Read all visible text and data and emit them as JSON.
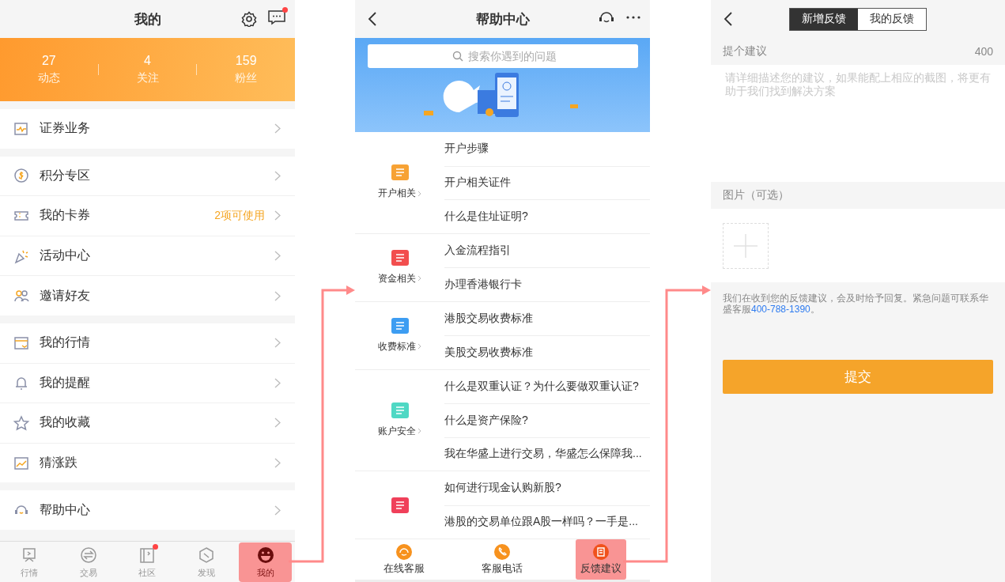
{
  "profile_screen": {
    "title": "我的",
    "messages_unread": true,
    "stats": [
      {
        "value": "27",
        "label": "动态"
      },
      {
        "value": "4",
        "label": "关注"
      },
      {
        "value": "159",
        "label": "粉丝"
      }
    ],
    "menu_groups": [
      {
        "items": [
          {
            "label": "证券业务"
          }
        ]
      },
      {
        "items": [
          {
            "label": "积分专区"
          },
          {
            "label": "我的卡券",
            "note": "2项可使用"
          },
          {
            "label": "活动中心"
          },
          {
            "label": "邀请好友"
          }
        ]
      },
      {
        "items": [
          {
            "label": "我的行情"
          },
          {
            "label": "我的提醒"
          },
          {
            "label": "我的收藏"
          },
          {
            "label": "猜涨跌"
          }
        ]
      },
      {
        "items": [
          {
            "label": "帮助中心"
          }
        ]
      }
    ],
    "tab_bar": [
      {
        "label": "行情",
        "selected": false,
        "dot": false
      },
      {
        "label": "交易",
        "selected": false,
        "dot": false
      },
      {
        "label": "社区",
        "selected": false,
        "dot": true
      },
      {
        "label": "发现",
        "selected": false,
        "dot": false
      },
      {
        "label": "我的",
        "selected": true,
        "dot": false
      }
    ]
  },
  "help_screen": {
    "title": "帮助中心",
    "search": {
      "placeholder": "搜索你遇到的问题"
    },
    "categories": [
      {
        "label": "开户相关",
        "color": "#f7a234",
        "questions": [
          "开户步骤",
          "开户相关证件",
          "什么是住址证明?"
        ]
      },
      {
        "label": "资金相关",
        "color": "#f24e4e",
        "questions": [
          "入金流程指引",
          "办理香港银行卡"
        ]
      },
      {
        "label": "收费标准",
        "color": "#3d9df2",
        "questions": [
          "港股交易收费标准",
          "美股交易收费标准"
        ]
      },
      {
        "label": "账户安全",
        "color": "#4fd8c4",
        "questions": [
          "什么是双重认证？为什么要做双重认证?",
          "什么是资产保险?",
          "我在华盛上进行交易，华盛怎么保障我..."
        ]
      },
      {
        "color": "#f0405a",
        "questions": [
          "如何进行现金认购新股?",
          "港股的交易单位跟A股一样吗？一手是..."
        ]
      }
    ],
    "bottom_actions": [
      {
        "label": "在线客服",
        "selected": false
      },
      {
        "label": "客服电话",
        "selected": false
      },
      {
        "label": "反馈建议",
        "selected": true
      }
    ]
  },
  "feedback_screen": {
    "tabs": [
      {
        "label": "新增反馈",
        "selected": true
      },
      {
        "label": "我的反馈",
        "selected": false
      }
    ],
    "suggestion_label": "提个建议",
    "char_count": "400",
    "placeholder": "请详细描述您的建议，如果能配上相应的截图，将更有助于我们找到解决方案",
    "photos_label": "图片（可选）",
    "notice": "我们在收到您的反馈建议，会及时给予回复。紧急问题可联系华盛客服",
    "phone": "400-788-1390",
    "notice_end": "。",
    "submit": "提交"
  }
}
